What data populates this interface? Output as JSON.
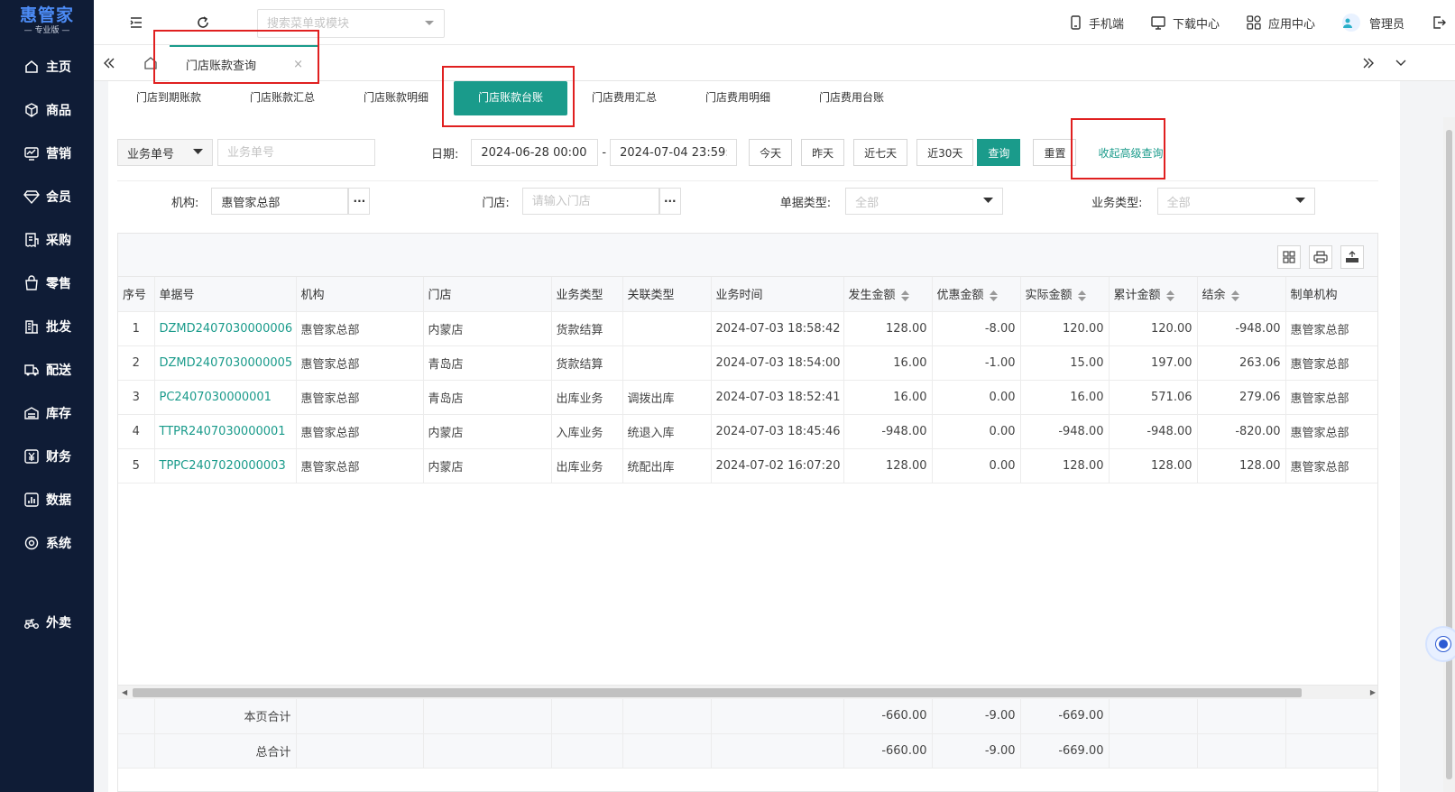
{
  "logo": {
    "name": "惠管家",
    "edition": "— 专业版 —"
  },
  "sidebar": {
    "items": [
      {
        "label": "主页",
        "icon": "home-icon"
      },
      {
        "label": "商品",
        "icon": "cube-icon"
      },
      {
        "label": "营销",
        "icon": "chart-icon"
      },
      {
        "label": "会员",
        "icon": "diamond-icon"
      },
      {
        "label": "采购",
        "icon": "receipt-icon"
      },
      {
        "label": "零售",
        "icon": "bag-icon"
      },
      {
        "label": "批发",
        "icon": "building-icon"
      },
      {
        "label": "配送",
        "icon": "truck-icon"
      },
      {
        "label": "库存",
        "icon": "warehouse-icon"
      },
      {
        "label": "财务",
        "icon": "yen-icon"
      },
      {
        "label": "数据",
        "icon": "data-icon"
      },
      {
        "label": "系统",
        "icon": "gear-icon"
      },
      {
        "label": "外卖",
        "icon": "takeout-icon"
      }
    ]
  },
  "topbar": {
    "search_placeholder": "搜索菜单或模块",
    "links": {
      "mobile": "手机端",
      "download": "下载中心",
      "apps": "应用中心",
      "user": "管理员"
    }
  },
  "tabs": {
    "current": "门店账款查询",
    "close": "×"
  },
  "subtabs": [
    "门店到期账款",
    "门店账款汇总",
    "门店账款明细",
    "门店账款台账",
    "门店费用汇总",
    "门店费用明细",
    "门店费用台账"
  ],
  "subtabs_active": "门店账款台账",
  "filters": {
    "doc_type_select": "业务单号",
    "doc_placeholder": "业务单号",
    "date_label": "日期:",
    "date_start": "2024-06-28 00:00:00",
    "date_sep": "-",
    "date_end": "2024-07-04 23:59:59",
    "today": "今天",
    "yesterday": "昨天",
    "last7": "近七天",
    "last30": "近30天",
    "query": "查询",
    "reset": "重置",
    "collapse": "收起高级查询",
    "org_label": "机构:",
    "org_value": "惠管家总部",
    "store_label": "门店:",
    "store_placeholder": "请输入门店",
    "bill_type_label": "单据类型:",
    "bill_type_value": "全部",
    "biz_type_label": "业务类型:",
    "biz_type_value": "全部",
    "more": "···"
  },
  "table": {
    "columns": [
      "序号",
      "单据号",
      "机构",
      "门店",
      "业务类型",
      "关联类型",
      "业务时间",
      "发生金额",
      "优惠金额",
      "实际金额",
      "累计金额",
      "结余",
      "制单机构"
    ],
    "rows": [
      [
        "1",
        "DZMD2407030000006",
        "惠管家总部",
        "内蒙店",
        "货款结算",
        "",
        "2024-07-03 18:58:42",
        "128.00",
        "-8.00",
        "120.00",
        "120.00",
        "-948.00",
        "惠管家总部"
      ],
      [
        "2",
        "DZMD2407030000005",
        "惠管家总部",
        "青岛店",
        "货款结算",
        "",
        "2024-07-03 18:54:00",
        "16.00",
        "-1.00",
        "15.00",
        "197.00",
        "263.06",
        "惠管家总部"
      ],
      [
        "3",
        "PC2407030000001",
        "惠管家总部",
        "青岛店",
        "出库业务",
        "调拨出库",
        "2024-07-03 18:52:41",
        "16.00",
        "0.00",
        "16.00",
        "571.06",
        "279.06",
        "惠管家总部"
      ],
      [
        "4",
        "TTPR2407030000001",
        "惠管家总部",
        "内蒙店",
        "入库业务",
        "统退入库",
        "2024-07-03 18:45:46",
        "-948.00",
        "0.00",
        "-948.00",
        "-948.00",
        "-820.00",
        "惠管家总部"
      ],
      [
        "5",
        "TPPC2407020000003",
        "惠管家总部",
        "内蒙店",
        "出库业务",
        "统配出库",
        "2024-07-02 16:07:20",
        "128.00",
        "0.00",
        "128.00",
        "128.00",
        "128.00",
        "惠管家总部"
      ]
    ],
    "summary": [
      {
        "label": "本页合计",
        "amount": "-660.00",
        "discount": "-9.00",
        "actual": "-669.00"
      },
      {
        "label": "总合计",
        "amount": "-660.00",
        "discount": "-9.00",
        "actual": "-669.00"
      }
    ]
  },
  "colors": {
    "sidebar_bg": "#0f1c36",
    "accent": "#1a9b8b",
    "highlight_box": "#e02020",
    "logo": "#4c8bf5"
  }
}
